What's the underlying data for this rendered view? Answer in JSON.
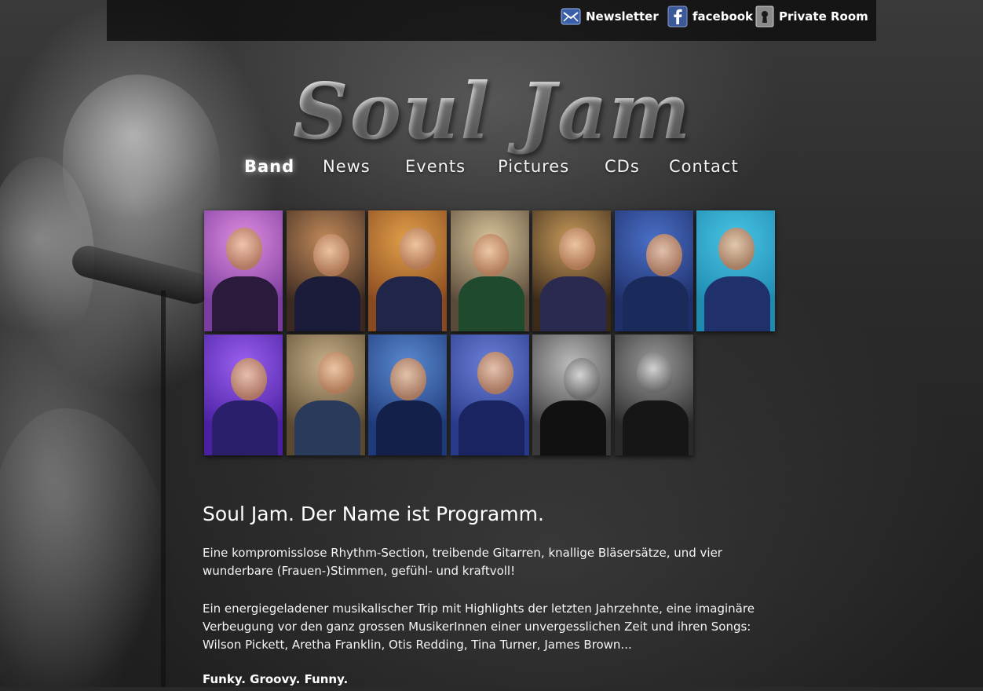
{
  "topbar": {
    "newsletter_label": "Newsletter",
    "facebook_label": "facebook",
    "private_room_label": "Private Room"
  },
  "logo": {
    "text": "Soul Jam"
  },
  "nav": {
    "items": [
      {
        "label": "Band",
        "active": true
      },
      {
        "label": "News",
        "active": false
      },
      {
        "label": "Events",
        "active": false
      },
      {
        "label": "Pictures",
        "active": false
      },
      {
        "label": "CDs",
        "active": false
      },
      {
        "label": "Contact",
        "active": false
      }
    ]
  },
  "gallery": {
    "members": [
      {
        "name": "singer-1",
        "bg": "#7a3c9e",
        "accent": "#e08de0",
        "outfit": "#2a1b3d"
      },
      {
        "name": "singer-2",
        "bg": "#3c2a20",
        "accent": "#c18a5a",
        "outfit": "#1a1c3a"
      },
      {
        "name": "singer-3",
        "bg": "#8a4a1f",
        "accent": "#e0a04a",
        "outfit": "#20264a"
      },
      {
        "name": "singer-4",
        "bg": "#5a4a3a",
        "accent": "#d8c49a",
        "outfit": "#1f4a2e"
      },
      {
        "name": "trumpet",
        "bg": "#3a2a1a",
        "accent": "#c89a5a",
        "outfit": "#2a2a50"
      },
      {
        "name": "harmonica",
        "bg": "#1f2f6a",
        "accent": "#4a70c8",
        "outfit": "#1a2a5a"
      },
      {
        "name": "saxophone",
        "bg": "#1f8ab0",
        "accent": "#48c4e4",
        "outfit": "#20306a"
      },
      {
        "name": "drums",
        "bg": "#4a20a0",
        "accent": "#9a60f0",
        "outfit": "#2a1f6a"
      },
      {
        "name": "bass",
        "bg": "#5a4a30",
        "accent": "#c8b08a",
        "outfit": "#2a3a5a"
      },
      {
        "name": "guitar",
        "bg": "#1f3a7a",
        "accent": "#5a8ad0",
        "outfit": "#14204a"
      },
      {
        "name": "keys",
        "bg": "#2a3a8a",
        "accent": "#6a80d8",
        "outfit": "#1a2460"
      },
      {
        "name": "percussion",
        "bg": "#3a3a3a",
        "accent": "#bdbdbd",
        "outfit": "#111111"
      },
      {
        "name": "guest",
        "bg": "#2a2a2a",
        "accent": "#9a9a9a",
        "outfit": "#161616"
      }
    ]
  },
  "content": {
    "headline": "Soul Jam. Der Name ist Programm.",
    "paragraph1": "Eine kompromisslose Rhythm-Section, treibende Gitarren, knallige Bläsersätze, und vier wunderbare (Frauen-)Stimmen, gefühl- und kraftvoll!",
    "paragraph2": "Ein energiegeladener musikalischer Trip mit Highlights der letzten Jahrzehnte, eine imaginäre Verbeugung vor den ganz grossen MusikerInnen einer unvergesslichen Zeit und ihren Songs: Wilson Pickett, Aretha Franklin, Otis Redding, Tina Turner, James Brown...",
    "tagline": "Funky. Groovy. Funny."
  },
  "icons": {
    "newsletter": "envelope-icon",
    "facebook": "facebook-icon",
    "private_room": "keyhole-icon"
  },
  "colors": {
    "background": "#2a2a2a",
    "topbar": "#0c0c0c",
    "text": "#ffffff",
    "newsletter_icon": "#3a5fa8",
    "facebook_icon": "#3b5998"
  }
}
